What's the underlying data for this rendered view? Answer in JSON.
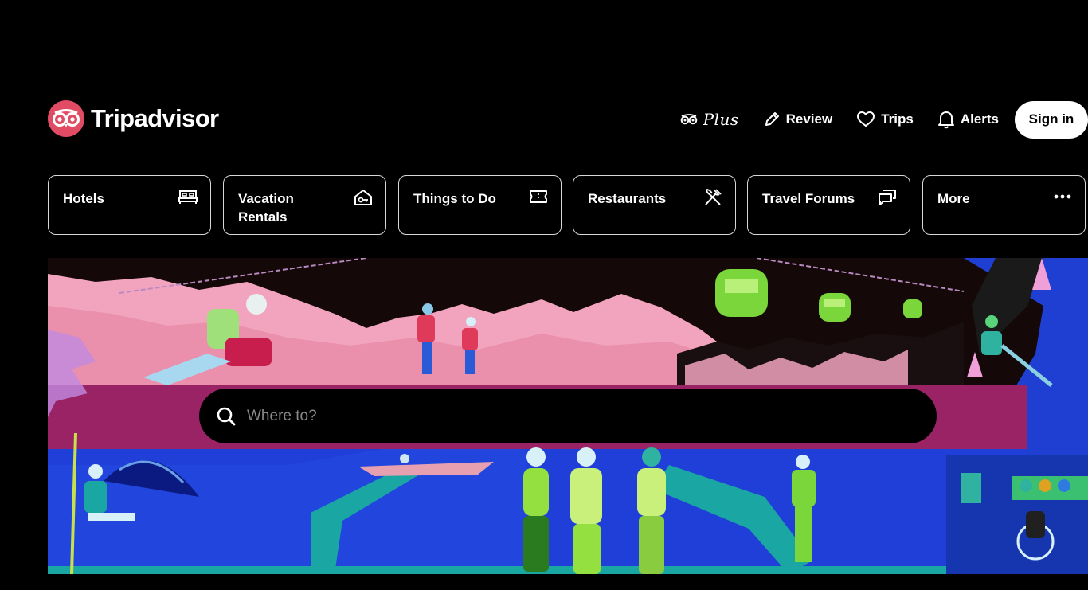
{
  "brand": {
    "name": "Tripadvisor",
    "color": "#e14b63"
  },
  "topnav": {
    "plus": "Plus",
    "review": "Review",
    "trips": "Trips",
    "alerts": "Alerts",
    "signin": "Sign in"
  },
  "categories": [
    {
      "label": "Hotels",
      "icon": "bed-icon"
    },
    {
      "label": "Vacation Rentals",
      "icon": "house-key-icon"
    },
    {
      "label": "Things to Do",
      "icon": "ticket-icon"
    },
    {
      "label": "Restaurants",
      "icon": "fork-knife-icon"
    },
    {
      "label": "Travel Forums",
      "icon": "chat-bubbles-icon"
    },
    {
      "label": "More",
      "icon": "ellipsis-icon"
    }
  ],
  "search": {
    "placeholder": "Where to?"
  },
  "colors": {
    "background": "#000000",
    "text": "#ffffff",
    "border": "#d7d7d7",
    "placeholder": "#8a8a8a"
  }
}
